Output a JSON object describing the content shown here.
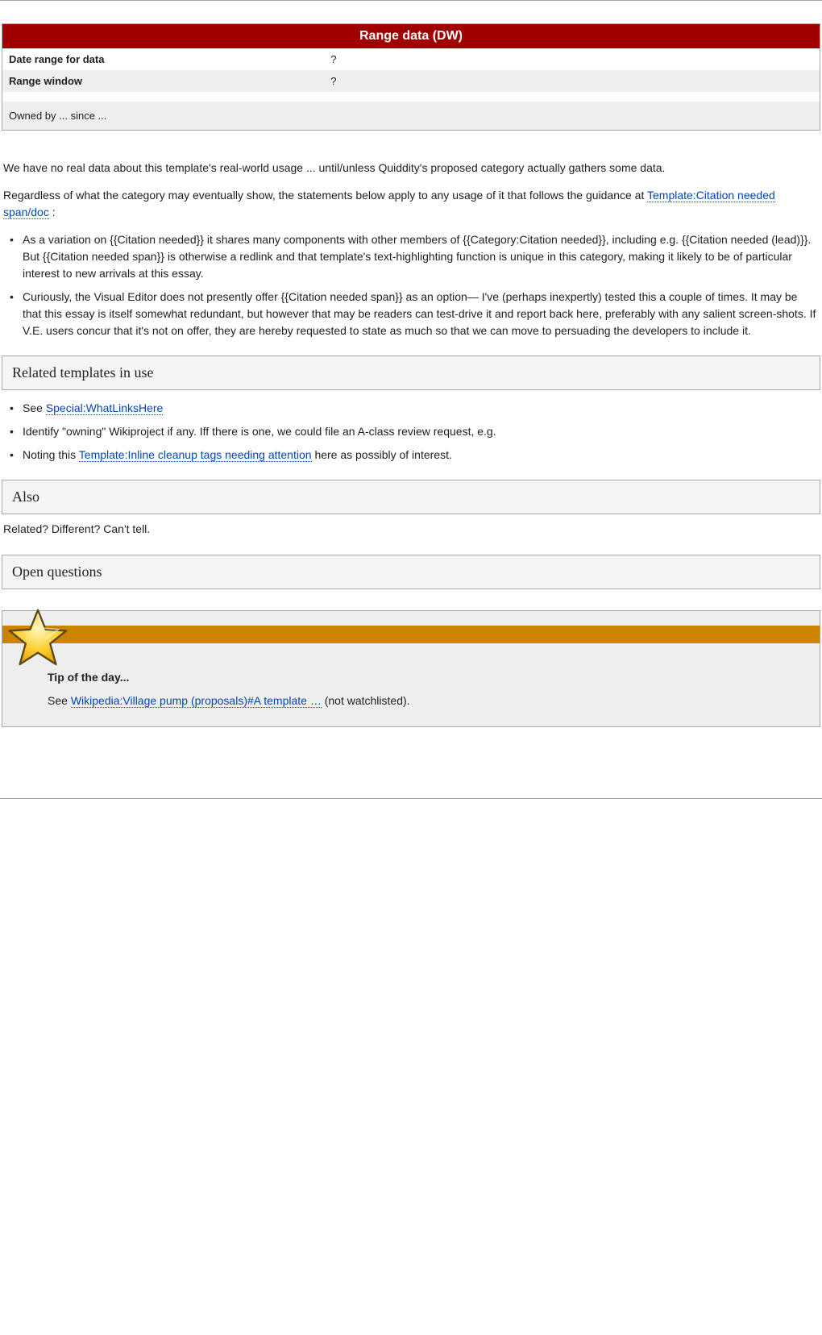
{
  "infobox": {
    "header": "Range data (DW)",
    "rows": [
      {
        "label": "Date range for data",
        "value": "?"
      },
      {
        "label": "Range window",
        "value": "?"
      }
    ],
    "footer": "Owned by ... since ..."
  },
  "paragraphs": [
    "We have no real data about this template's real-world usage ... until/unless Quiddity's proposed category actually gathers some data.",
    "Regardless of what the category may eventually show, the statements below apply to any usage of it that follows the guidance at Template:Citation needed span/doc :"
  ],
  "bullets_info": [
    "As a variation on {{Citation needed}} it shares many components with other members of {{Category:Citation needed}}, including e.g. {{Citation needed (lead)}}. But {{Citation needed span}} is otherwise a redlink and that template's text-highlighting function is unique in this category, making it likely to be of particular interest to new arrivals at this essay.",
    "Curiously, the Visual Editor does not presently offer {{Citation needed span}} as an option— I've (perhaps inexpertly) tested this a couple of times. It may be that this essay is itself somewhat redundant, but however that may be readers can test-drive it and report back here, preferably with any salient screen-shots. If V.E. users concur that it's not on offer, they are hereby requested to state as much so that we can move to persuading the developers to include it."
  ],
  "links": {
    "doc_link": "Template:Citation needed span/doc",
    "whatlinkshere": "Special:WhatLinksHere",
    "attention_template": "Template:Inline cleanup tags needing attention",
    "vp_proposals": "Wikipedia:Village pump (proposals)#A template …"
  },
  "sections": {
    "related": "Related templates in use",
    "also": "Also",
    "open": "Open questions",
    "tip": "Tip of the day..."
  },
  "also_text": "Related? Different? Can't tell.",
  "related_bullets": [
    {
      "prefix": "See ",
      "link": "Special:WhatLinksHere",
      "suffix": ""
    },
    {
      "prefix": "",
      "text": "Identify \"owning\" Wikiproject if any. Iff there is one, we could file an A-class review request, e.g."
    },
    {
      "prefix": "Noting this ",
      "link": "Template:Inline cleanup tags needing attention",
      "suffix": " here as possibly of interest."
    }
  ],
  "tip": {
    "text_prefix": "See ",
    "link": "Wikipedia:Village pump (proposals)#A template …",
    "text_suffix": " (not watchlisted)."
  }
}
